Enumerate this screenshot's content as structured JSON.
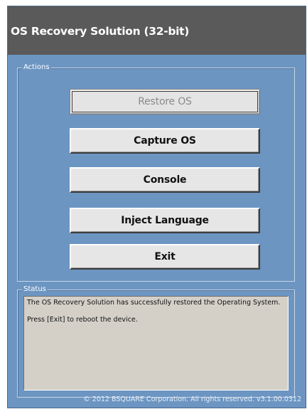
{
  "window": {
    "title": "OS Recovery Solution (32-bit)"
  },
  "actions": {
    "group_label": "Actions",
    "buttons": [
      {
        "label": "Restore OS",
        "enabled": false
      },
      {
        "label": "Capture OS",
        "enabled": true
      },
      {
        "label": "Console",
        "enabled": true
      },
      {
        "label": "Inject Language",
        "enabled": true
      },
      {
        "label": "Exit",
        "enabled": true
      }
    ]
  },
  "status": {
    "group_label": "Status",
    "lines": [
      "The OS Recovery Solution has successfully restored the Operating System.",
      "Press [Exit] to reboot the device."
    ]
  },
  "footer": {
    "copyright": "© 2012 BSQUARE Corporation. All rights reserved. v3.1.00.0312"
  },
  "colors": {
    "background": "#6c95c2",
    "titlebar": "#5a5a5a",
    "button_face": "#e6e6e6",
    "status_box": "#d4d0c8"
  }
}
